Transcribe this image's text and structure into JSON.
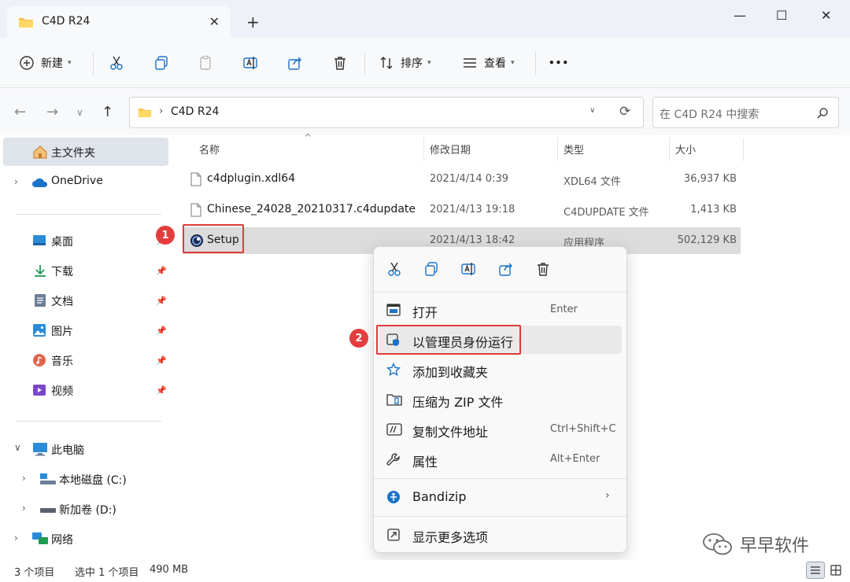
{
  "window": {
    "tab_title": "C4D R24",
    "minimize": "—",
    "maximize": "☐",
    "close": "✕",
    "new_tab": "+",
    "tab_close": "✕"
  },
  "commandbar": {
    "new_label": "新建",
    "sort_label": "排序",
    "view_label": "查看",
    "more": "•••"
  },
  "address": {
    "crumb": "C4D R24",
    "separator": "›",
    "search_placeholder": "在 C4D R24 中搜索"
  },
  "sidebar": {
    "home": "主文件夹",
    "onedrive": "OneDrive",
    "quick": [
      {
        "label": "桌面"
      },
      {
        "label": "下载"
      },
      {
        "label": "文档"
      },
      {
        "label": "图片"
      },
      {
        "label": "音乐"
      },
      {
        "label": "视频"
      }
    ],
    "this_pc": "此电脑",
    "drive_c": "本地磁盘 (C:)",
    "drive_d": "新加卷 (D:)",
    "network": "网络"
  },
  "columns": {
    "name": "名称",
    "date": "修改日期",
    "type": "类型",
    "size": "大小"
  },
  "files": [
    {
      "name": "c4dplugin.xdl64",
      "date": "2021/4/14 0:39",
      "type": "XDL64 文件",
      "size": "36,937 KB"
    },
    {
      "name": "Chinese_24028_20210317.c4dupdate",
      "date": "2021/4/13 19:18",
      "type": "C4DUPDATE 文件",
      "size": "1,413 KB"
    },
    {
      "name": "Setup",
      "date": "2021/4/13 18:42",
      "type": "应用程序",
      "size": "502,129 KB"
    }
  ],
  "context_menu": {
    "open": "打开",
    "open_key": "Enter",
    "run_as_admin": "以管理员身份运行",
    "add_favorites": "添加到收藏夹",
    "compress_zip": "压缩为 ZIP 文件",
    "copy_path": "复制文件地址",
    "copy_path_key": "Ctrl+Shift+C",
    "properties": "属性",
    "properties_key": "Alt+Enter",
    "bandizip": "Bandizip",
    "more_options": "显示更多选项"
  },
  "annotations": {
    "step1": "1",
    "step2": "2"
  },
  "status": {
    "count": "3 个项目",
    "selected": "选中 1 个项目",
    "size": "490 MB"
  },
  "watermark": {
    "text": "早早软件"
  },
  "colors": {
    "accent": "#0067c0",
    "highlight": "#e03a3a",
    "folder": "#f6c343"
  }
}
